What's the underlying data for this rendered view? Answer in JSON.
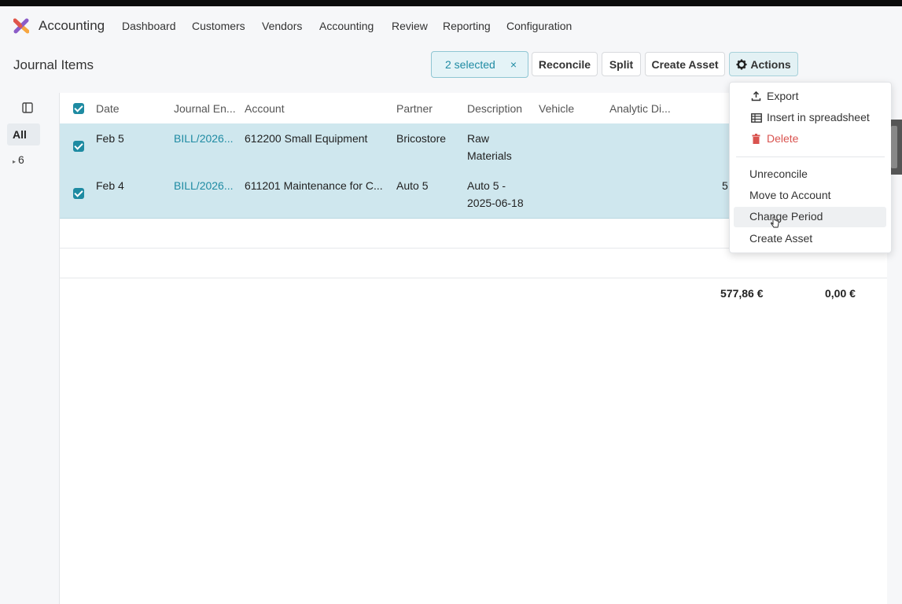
{
  "navbar": {
    "app_name": "Accounting",
    "items": [
      "Dashboard",
      "Customers",
      "Vendors",
      "Accounting",
      "Review",
      "Reporting",
      "Configuration"
    ]
  },
  "control_panel": {
    "title": "Journal Items",
    "selected_label": "2 selected",
    "clear_icon": "×",
    "buttons": {
      "reconcile": "Reconcile",
      "split": "Split",
      "create_asset": "Create Asset",
      "actions": "Actions"
    }
  },
  "side_panel": {
    "all_label": "All",
    "group_label": "6"
  },
  "table": {
    "headers": [
      "Date",
      "Journal En...",
      "Account",
      "Partner",
      "Description",
      "Vehicle",
      "Analytic Di..."
    ],
    "rows": [
      {
        "date": "Feb 5",
        "journal": "BILL/2026...",
        "account": "612200 Small Equipment",
        "partner": "Bricostore",
        "description_line1": "Raw",
        "description_line2": "Materials",
        "trailing": ""
      },
      {
        "date": "Feb 4",
        "journal": "BILL/2026...",
        "account": "611201 Maintenance for C...",
        "partner": "Auto 5",
        "description_line1": "Auto 5 -",
        "description_line2": "2025-06-18",
        "trailing": "5"
      }
    ],
    "totals": {
      "debit": "577,86 €",
      "credit": "0,00 €"
    }
  },
  "actions_menu": {
    "items": [
      {
        "key": "export",
        "label": "Export",
        "icon": "upload-icon"
      },
      {
        "key": "insert",
        "label": "Insert in spreadsheet",
        "icon": "spreadsheet-icon"
      },
      {
        "key": "delete",
        "label": "Delete",
        "icon": "trash-icon"
      },
      {
        "key": "unreconcile",
        "label": "Unreconcile"
      },
      {
        "key": "move",
        "label": "Move to Account"
      },
      {
        "key": "change_period",
        "label": "Change Period"
      },
      {
        "key": "create_asset",
        "label": "Create Asset"
      }
    ]
  },
  "colors": {
    "accent": "#1f8ba3",
    "selected_row": "#cfe7ee",
    "danger": "#d9534f"
  }
}
